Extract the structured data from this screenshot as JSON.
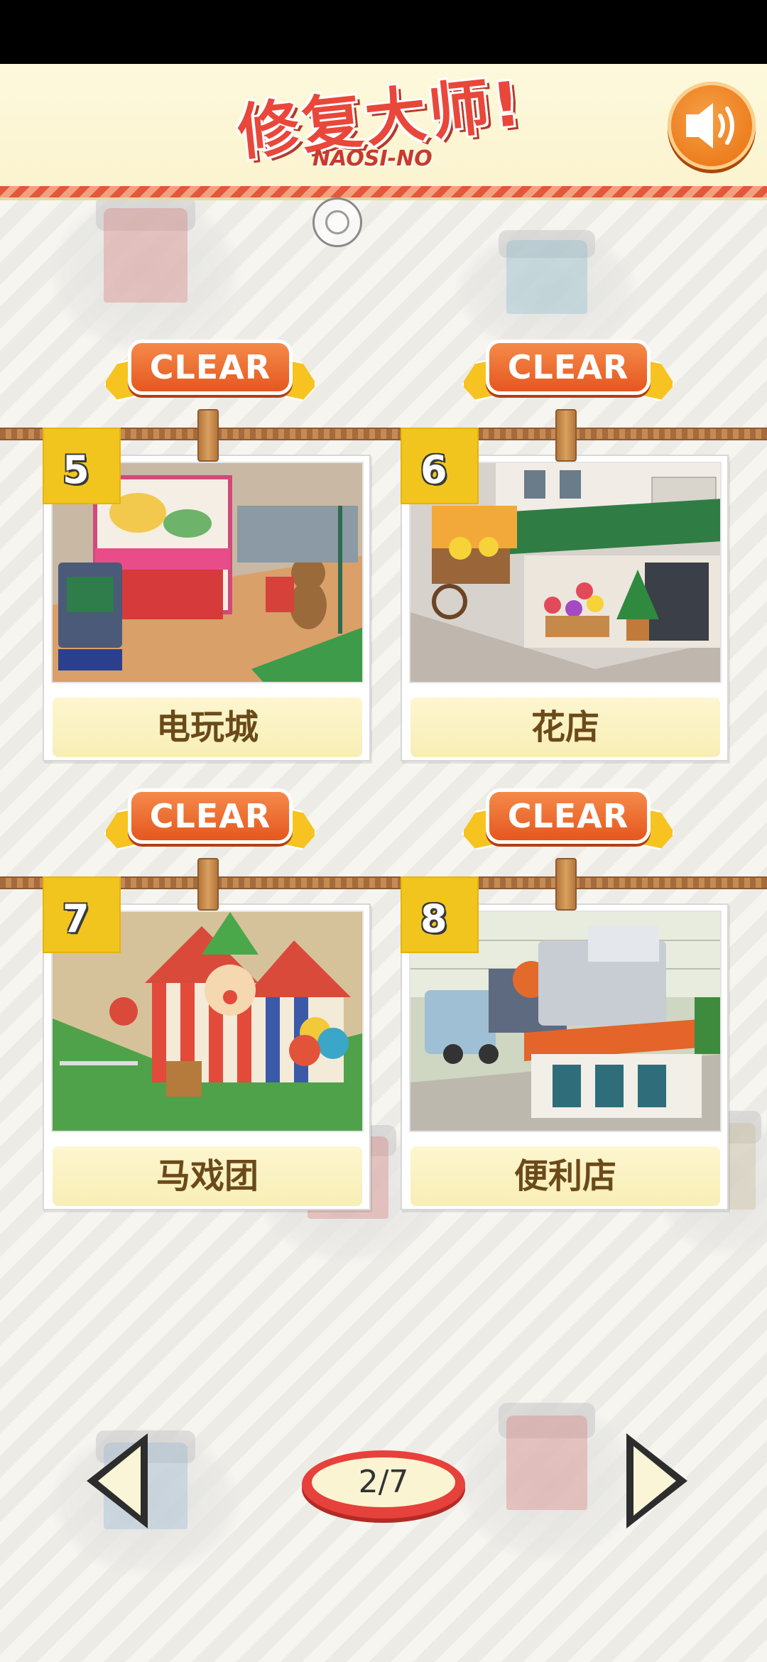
{
  "header": {
    "logo_title": "修复大师!",
    "logo_subtitle": "NAOSI-NO",
    "sound_icon": "speaker-icon"
  },
  "levels": [
    {
      "number": "5",
      "name": "电玩城",
      "badge": "CLEAR",
      "scene": "arcade"
    },
    {
      "number": "6",
      "name": "花店",
      "badge": "CLEAR",
      "scene": "flower-shop"
    },
    {
      "number": "7",
      "name": "马戏团",
      "badge": "CLEAR",
      "scene": "circus"
    },
    {
      "number": "8",
      "name": "便利店",
      "badge": "CLEAR",
      "scene": "convenience-store"
    }
  ],
  "pagination": {
    "label": "2/7",
    "current": 2,
    "total": 7
  },
  "colors": {
    "accent": "#e9473a",
    "ribbon": "#ef6a2e",
    "number_tab": "#f1c51d",
    "sound_button": "#ec7c1c"
  }
}
